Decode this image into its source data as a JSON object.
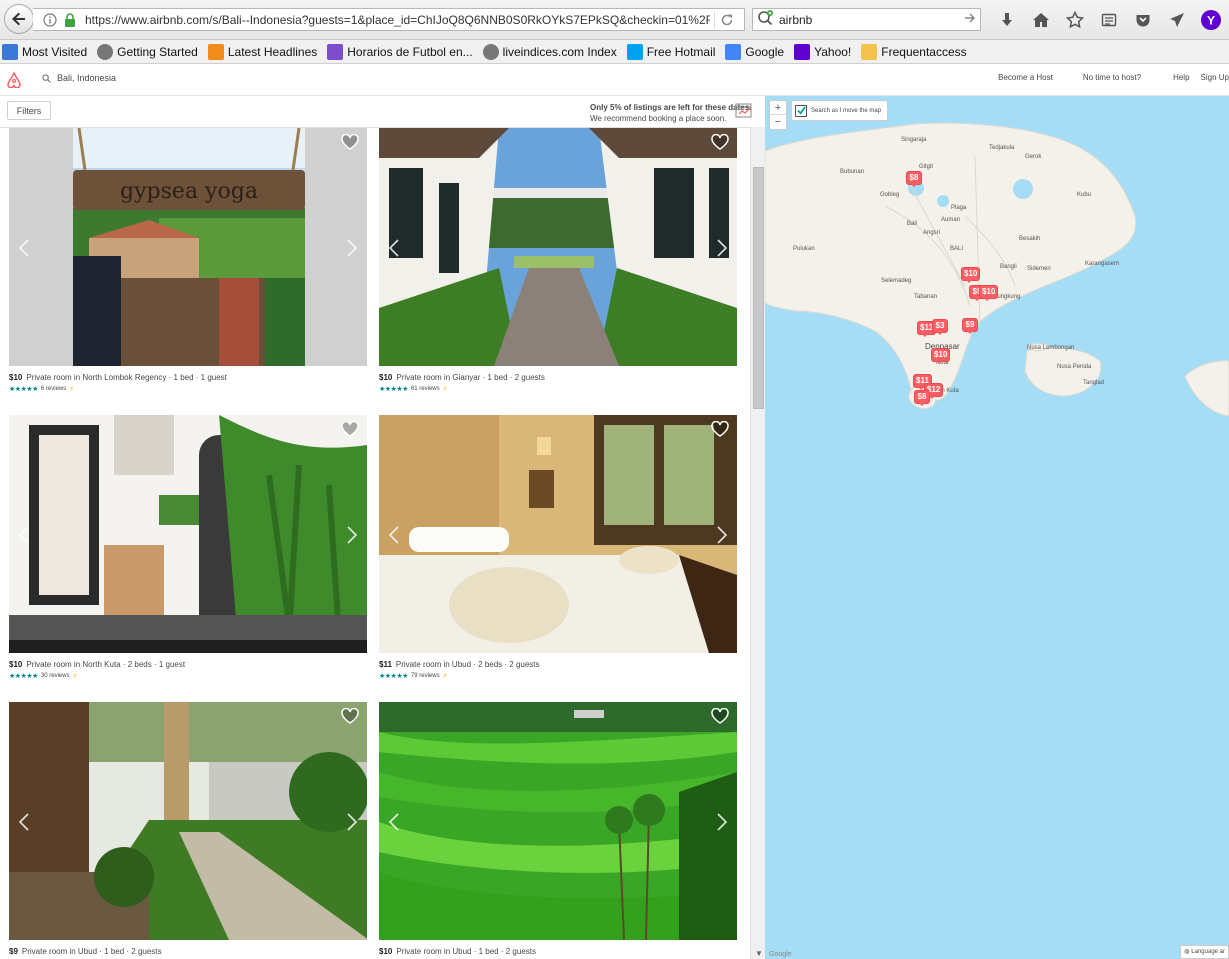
{
  "browser": {
    "url": "https://www.airbnb.com/s/Bali--Indonesia?guests=1&place_id=ChIJoQ8Q6NNB0S0RkOYkS7EPkSQ&checkin=01%2F01%2F2",
    "search_query": "airbnb",
    "toolbar_icons": [
      "download-icon",
      "home-icon",
      "bookmark-star-icon",
      "reading-list-icon",
      "pocket-icon",
      "send-icon",
      "yahoo-icon"
    ]
  },
  "bookmarks": [
    {
      "label": "Most Visited",
      "icon": "most-visited-icon",
      "color": "#3a79d6"
    },
    {
      "label": "Getting Started",
      "icon": "globe-icon",
      "color": "#777777"
    },
    {
      "label": "Latest Headlines",
      "icon": "rss-icon",
      "color": "#f28d1c"
    },
    {
      "label": "Horarios de Futbol en...",
      "icon": "peacock-icon",
      "color": "#7c4dcc"
    },
    {
      "label": "liveindices.com  Index",
      "icon": "globe-icon",
      "color": "#777777"
    },
    {
      "label": "Free Hotmail",
      "icon": "windows-icon",
      "color": "#00a1f1"
    },
    {
      "label": "Google",
      "icon": "google-icon",
      "color": "#4285f4"
    },
    {
      "label": "Yahoo!",
      "icon": "yahoo-icon",
      "color": "#5f01d1"
    },
    {
      "label": "Frequentaccess",
      "icon": "folder-icon",
      "color": "#f2c14e"
    }
  ],
  "site": {
    "search_location": "Bali, Indonesia",
    "links": [
      "Become a Host",
      "No time to host?",
      "Help",
      "Sign Up"
    ]
  },
  "filters": {
    "button_label": "Filters",
    "notice_bold": "Only 5% of listings are left for these dates.",
    "notice_sub": "We recommend booking a place soon."
  },
  "listings": [
    {
      "price": "$10",
      "title": "Private room in North Lombok Regency · 1 bed · 1 guest",
      "reviews": "6 reviews",
      "stars": "★★★★★",
      "instant": "⚡"
    },
    {
      "price": "$10",
      "title": "Private room in Gianyar · 1 bed · 2 guests",
      "reviews": "61 reviews",
      "stars": "★★★★★",
      "instant": "⚡"
    },
    {
      "price": "$10",
      "title": "Private room in North Kuta · 2 beds · 1 guest",
      "reviews": "30 reviews",
      "stars": "★★★★★",
      "instant": "⚡"
    },
    {
      "price": "$11",
      "title": "Private room in Ubud · 2 beds · 2 guests",
      "reviews": "79 reviews",
      "stars": "★★★★★",
      "instant": "⚡"
    },
    {
      "price": "$9",
      "title": "Private room in Ubud · 1 bed · 2 guests",
      "reviews": "",
      "stars": "",
      "instant": ""
    },
    {
      "price": "$10",
      "title": "Private room in Ubud · 1 bed · 2 guests",
      "reviews": "",
      "stars": "",
      "instant": ""
    }
  ],
  "map": {
    "search_as_move": "Search as I move the map",
    "zoom_in": "+",
    "zoom_out": "−",
    "labels": [
      "Tedjakula",
      "Gerok",
      "Singaraja",
      "Bubunan",
      "Gitgit",
      "Gobleg",
      "Kubu",
      "Plaga",
      "Bali",
      "Auman",
      "Angsri",
      "BALI",
      "Besakih",
      "Pulukan",
      "Bangli",
      "Sidemen",
      "Karangasem",
      "Selemadeg",
      "Klungkung",
      "Tabanan",
      "Denpasar",
      "Nusa Lembongan",
      "Nusa Penida",
      "Tanglad",
      "Kuta",
      "South Kuta"
    ],
    "pins": [
      "$8",
      "$10",
      "$9",
      "$10",
      "$9",
      "$13",
      "$3",
      "$10",
      "$11",
      "$12",
      "$8"
    ],
    "google": "Google",
    "language": "Language ar"
  }
}
